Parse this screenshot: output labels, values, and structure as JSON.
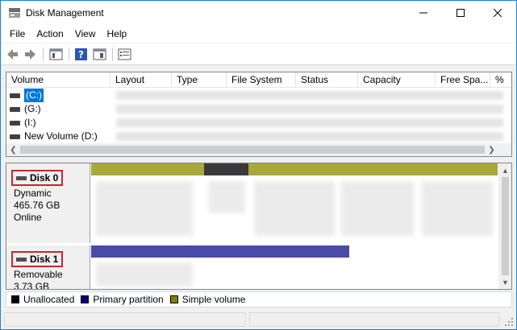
{
  "window": {
    "title": "Disk Management",
    "icon": "disk-management-icon"
  },
  "menu": [
    "File",
    "Action",
    "View",
    "Help"
  ],
  "toolbar": {
    "icons": [
      "back-arrow-icon",
      "forward-arrow-icon",
      "console-tree-icon",
      "help-icon",
      "show-hide-icon",
      "properties-icon"
    ]
  },
  "list": {
    "columns": [
      "Volume",
      "Layout",
      "Type",
      "File System",
      "Status",
      "Capacity",
      "Free Spa...",
      "%"
    ],
    "rows": [
      {
        "name": "(C:)",
        "selected": true
      },
      {
        "name": "(G:)",
        "selected": false
      },
      {
        "name": "(I:)",
        "selected": false
      },
      {
        "name": "New Volume (D:)",
        "selected": false
      }
    ]
  },
  "disks": [
    {
      "title": "Disk 0",
      "kind": "Dynamic",
      "size": "465.76 GB",
      "state": "Online"
    },
    {
      "title": "Disk 1",
      "kind": "Removable",
      "size": "3.73 GB"
    }
  ],
  "legend": [
    {
      "label": "Unallocated",
      "color": "#000000"
    },
    {
      "label": "Primary partition",
      "color": "#00007b"
    },
    {
      "label": "Simple volume",
      "color": "#808000"
    }
  ],
  "colors": {
    "simple_volume": "#a9a83b",
    "primary_partition": "#4a4aa8",
    "selected_row": "#0078d7",
    "annotation_box": "#c62828"
  }
}
